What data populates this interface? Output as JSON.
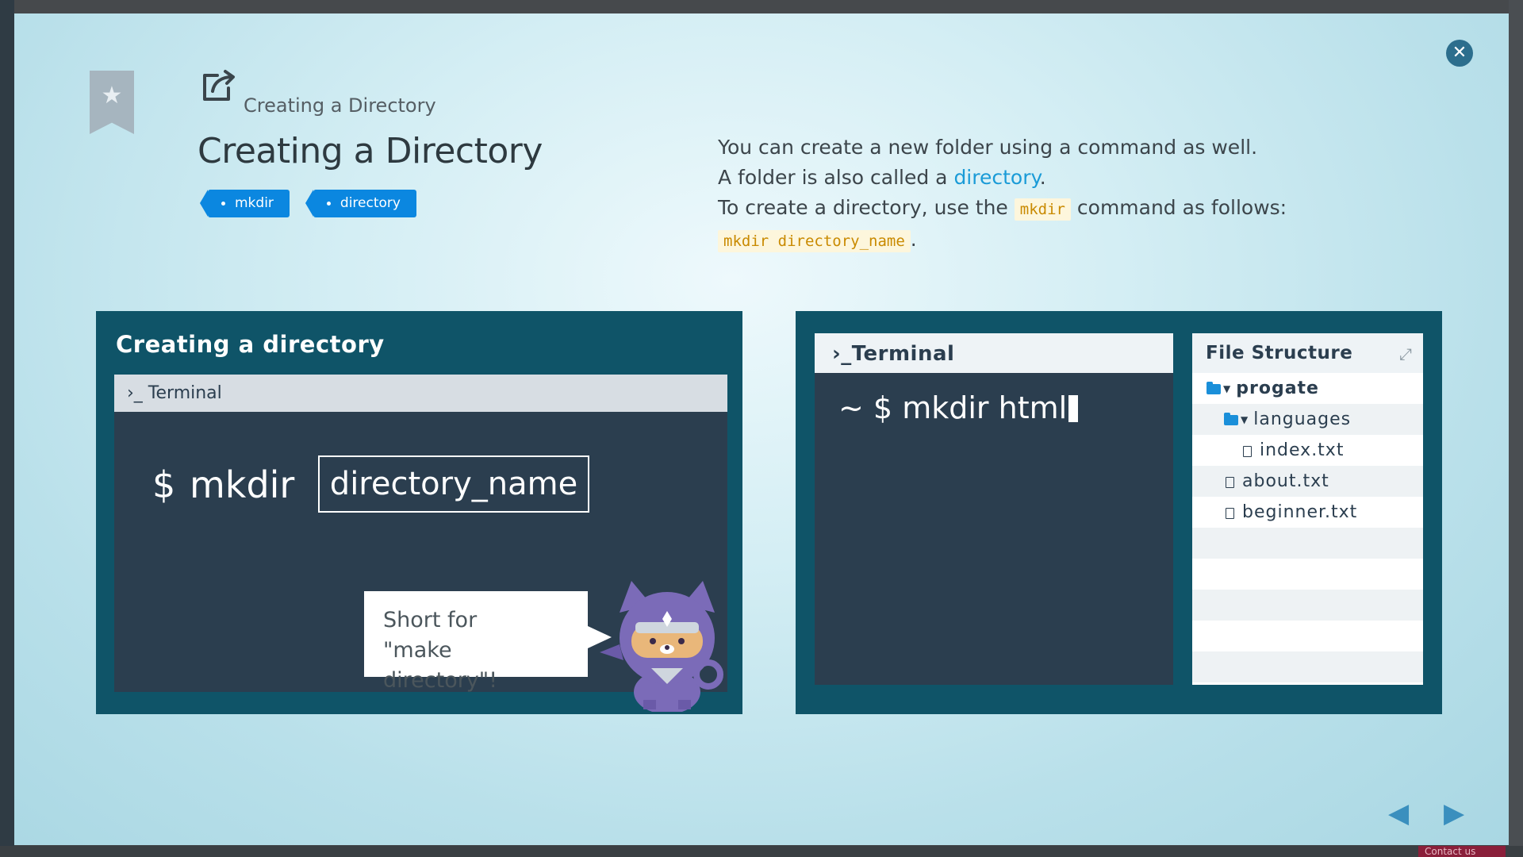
{
  "lesson": {
    "breadcrumb": "Creating a Directory",
    "title": "Creating a Directory",
    "tags": [
      "mkdir",
      "directory"
    ],
    "description": {
      "line1": "You can create a new folder using a command as well.",
      "line2_pre": "A folder is also called a ",
      "line2_link": "directory",
      "line2_post": ".",
      "line3_pre": "To create a directory, use the ",
      "line3_code": "mkdir",
      "line3_post": " command as follows:",
      "line4_code": "mkdir directory_name",
      "line4_post": "."
    }
  },
  "illustration_left": {
    "title": "Creating a directory",
    "terminal_label": "Terminal",
    "prompt": "$",
    "command": "mkdir",
    "argument": "directory_name",
    "bubble_line1": "Short for",
    "bubble_line2": "\"make directory\"!"
  },
  "illustration_right": {
    "terminal_label": "Terminal",
    "prompt": "~ $",
    "command": "mkdir html",
    "file_structure": {
      "title": "File Structure",
      "items": [
        "progate",
        "languages",
        "index.txt",
        "about.txt",
        "beginner.txt"
      ]
    }
  },
  "footer": {
    "contact": "Contact us"
  },
  "colors": {
    "accent": "#0b87e0",
    "panel": "#0f5468",
    "terminal": "#2b3e4f",
    "link": "#1a9bd7"
  },
  "icons": [
    "close-icon",
    "bookmark-star-icon",
    "external-link-icon",
    "folder-icon",
    "file-icon",
    "expand-icon",
    "prev-arrow-icon",
    "next-arrow-icon"
  ]
}
